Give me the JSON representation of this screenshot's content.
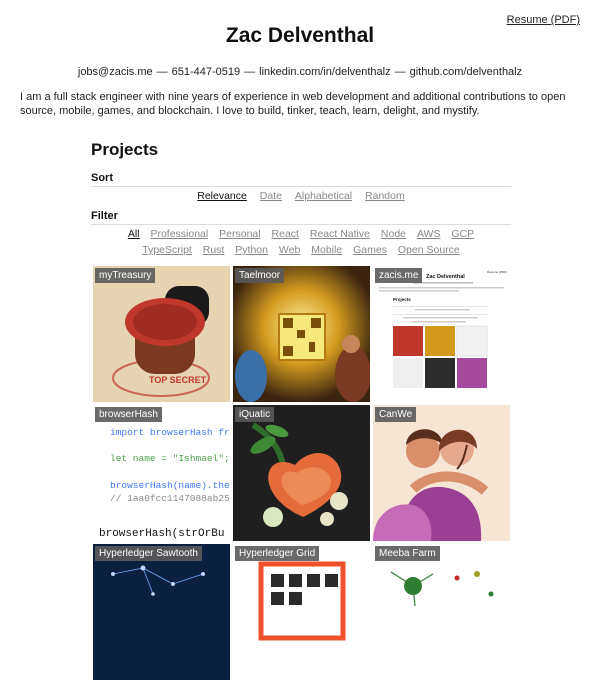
{
  "header": {
    "resume_label": "Resume (PDF)",
    "name": "Zac Delventhal",
    "contact": [
      "jobs@zacis.me",
      "651-447-0519",
      "linkedin.com/in/delventhalz",
      "github.com/delventhalz"
    ],
    "separator": "—",
    "intro": "I am a full stack engineer with nine years of experience in web development and additional contributions to open source, mobile, games, and blockchain. I love to build, tinker, teach, learn, delight, and mystify."
  },
  "projects": {
    "title": "Projects",
    "sort_label": "Sort",
    "sort_options": [
      "Relevance",
      "Date",
      "Alphabetical",
      "Random"
    ],
    "sort_selected": "Relevance",
    "filter_label": "Filter",
    "filter_row1": [
      "All",
      "Professional",
      "Personal",
      "React",
      "React Native",
      "Node",
      "AWS",
      "GCP"
    ],
    "filter_row2": [
      "TypeScript",
      "Rust",
      "Python",
      "Web",
      "Mobile",
      "Games",
      "Open Source"
    ],
    "filter_selected": "All",
    "tiles": [
      "myTreasury",
      "Taelmoor",
      "zacis.me",
      "browserHash",
      "iQuatic",
      "CanWe",
      "Hyperledger Sawtooth",
      "Hyperledger Grid",
      "Meeba Farm"
    ]
  },
  "tile_content": {
    "stamp_text": "TOP SECRET",
    "code_lines": [
      "import browserHash fr",
      "let name = \"Ishmael\";",
      "browserHash(name).the",
      "// 1aa0fcc1147088ab25",
      "browserHash(strOrBu"
    ],
    "mini_title": "Zac Delventhal",
    "mini_resume": "Resume (PDF)",
    "mini_section": "Projects"
  },
  "colors": {
    "stamp_red": "#c0382b",
    "paper": "#e6d3b1",
    "code_keyword": "#a626a4",
    "code_func": "#4078f2",
    "code_string": "#50a14f",
    "code_comment": "#888888",
    "grid_orange": "#f0512a",
    "purple_dress": "#9b3f95"
  }
}
